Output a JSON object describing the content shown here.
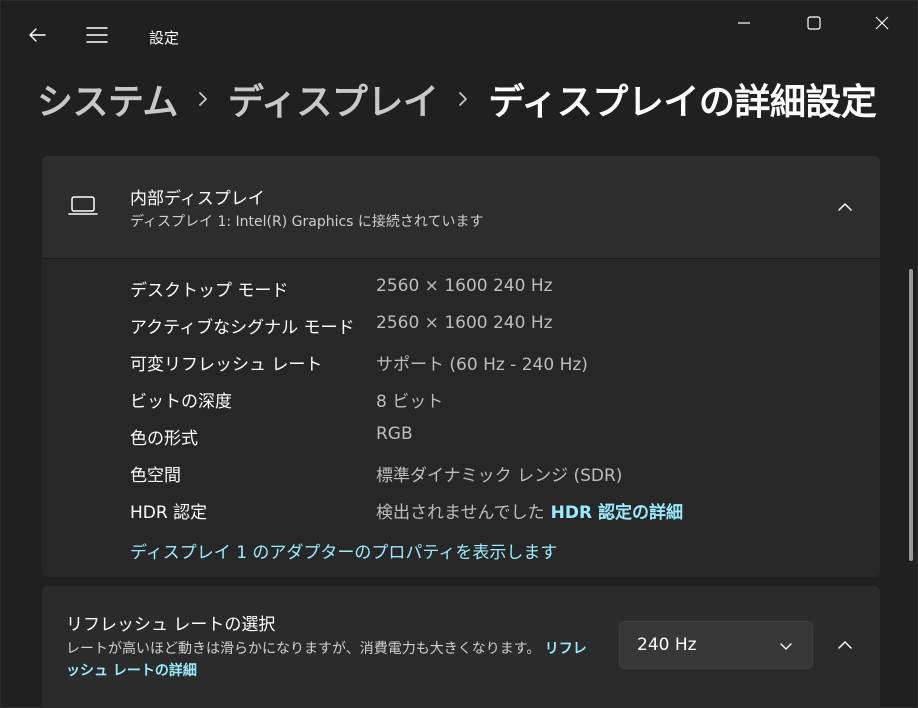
{
  "titlebar": {
    "app_title": "設定",
    "back_icon": "back-arrow-icon",
    "menu_icon": "hamburger-menu-icon",
    "minimize_icon": "minimize-icon",
    "maximize_icon": "maximize-icon",
    "close_icon": "close-icon"
  },
  "breadcrumb": {
    "items": [
      {
        "label": "システム"
      },
      {
        "label": "ディスプレイ"
      },
      {
        "label": "ディスプレイの詳細設定"
      }
    ],
    "separator_icon": "chevron-right-icon"
  },
  "display_card": {
    "icon": "laptop-icon",
    "title": "内部ディスプレイ",
    "subtitle": "ディスプレイ 1: Intel(R) Graphics に接続されています",
    "collapse_icon": "chevron-up-icon",
    "properties": [
      {
        "label": "デスクトップ モード",
        "value": "2560 × 1600 240 Hz"
      },
      {
        "label": "アクティブなシグナル モード",
        "value": "2560 × 1600 240 Hz"
      },
      {
        "label": "可変リフレッシュ レート",
        "value": "サポート (60 Hz - 240 Hz)"
      },
      {
        "label": "ビットの深度",
        "value": "8 ビット"
      },
      {
        "label": "色の形式",
        "value": "RGB"
      },
      {
        "label": "色空間",
        "value": "標準ダイナミック レンジ (SDR)"
      },
      {
        "label": "HDR 認定",
        "value": "検出されませんでした",
        "link": "HDR 認定の詳細"
      }
    ],
    "adapter_link": "ディスプレイ 1 のアダプターのプロパティを表示します"
  },
  "refresh_card": {
    "title": "リフレッシュ レートの選択",
    "description": "レートが高いほど動きは滑らかになりますが、消費電力も大きくなります。",
    "link": "リフレッシュ レートの詳細",
    "selected_rate": "240 Hz",
    "dropdown_icon": "chevron-down-icon",
    "collapse_icon": "chevron-up-icon"
  },
  "colors": {
    "background": "#202020",
    "card": "#2b2b2b",
    "accent_link": "#99ebff",
    "text_secondary": "#bdbdbd"
  }
}
